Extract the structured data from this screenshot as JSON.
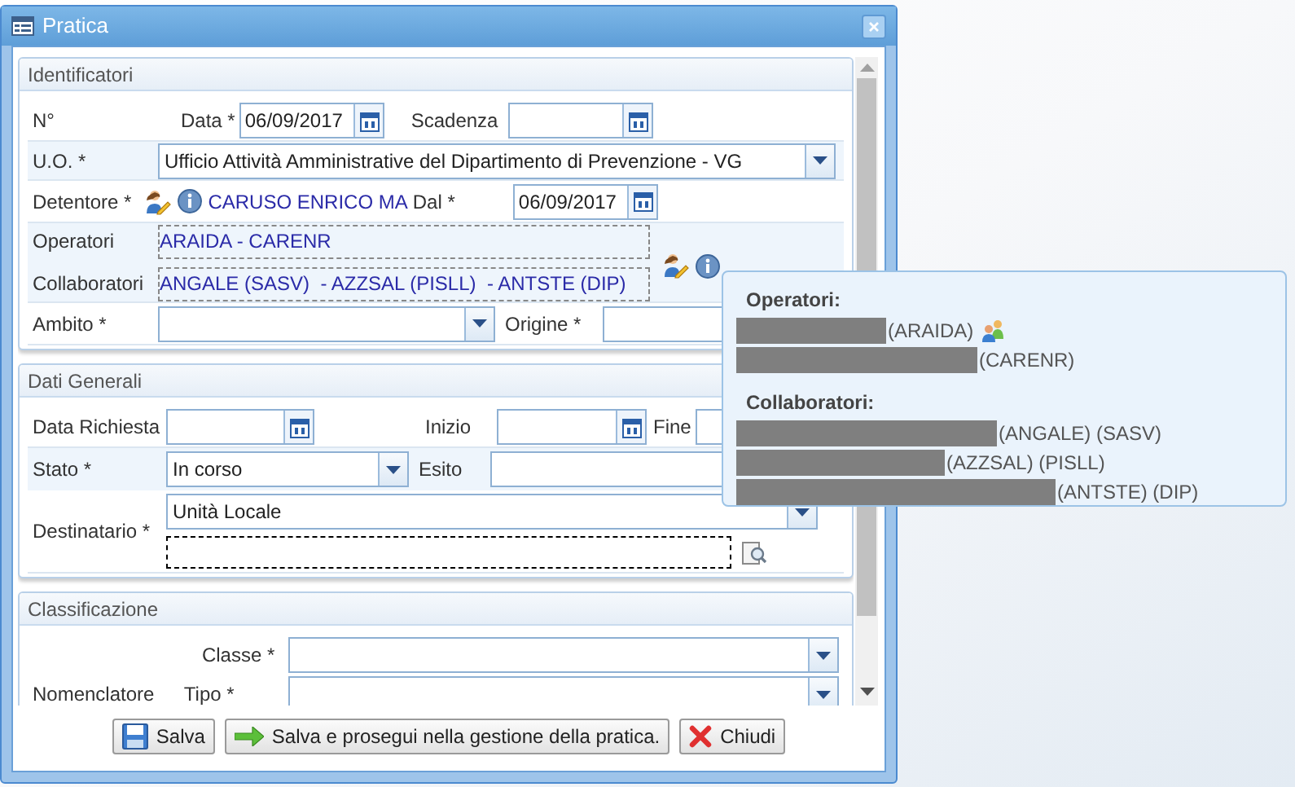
{
  "window": {
    "title": "Pratica"
  },
  "identificatori": {
    "title": "Identificatori",
    "numero_label": "N°",
    "data": {
      "label": "Data *",
      "value": "06/09/2017"
    },
    "scadenza": {
      "label": "Scadenza"
    },
    "uo": {
      "label": "U.O. *",
      "value": "Ufficio Attività Amministrative del Dipartimento di Prevenzione - VG"
    },
    "detentore": {
      "label": "Detentore *",
      "name": "CARUSO ENRICO MA",
      "dal_label": "Dal *",
      "dal_value": "06/09/2017"
    },
    "operatori": {
      "label": "Operatori",
      "value": "ARAIDA - CARENR"
    },
    "collaboratori": {
      "label": "Collaboratori",
      "value": "ANGALE (SASV)  - AZZSAL (PISLL)  - ANTSTE (DIP)"
    },
    "ambito": {
      "label": "Ambito *"
    },
    "origine": {
      "label": "Origine *"
    }
  },
  "dati_generali": {
    "title": "Dati Generali",
    "data_richiesta": {
      "label": "Data Richiesta"
    },
    "inizio": {
      "label": "Inizio"
    },
    "fine": {
      "label": "Fine"
    },
    "stato": {
      "label": "Stato *",
      "value": "In corso"
    },
    "esito": {
      "label": "Esito"
    },
    "destinatario": {
      "label": "Destinatario *",
      "value": "Unità Locale"
    }
  },
  "classificazione": {
    "title": "Classificazione",
    "classe": {
      "label": "Classe *"
    },
    "nomenclatore": {
      "label": "Nomenclatore"
    },
    "tipo": {
      "label": "Tipo *"
    }
  },
  "buttons": [
    {
      "kind": "save",
      "label": "Salva"
    },
    {
      "kind": "forward",
      "label": "Salva e prosegui nella gestione della pratica."
    },
    {
      "kind": "close",
      "label": "Chiudi"
    }
  ],
  "tooltip": {
    "sections": [
      {
        "title": "Operatori:",
        "entries": [
          {
            "code": "(ARAIDA)",
            "group_icon": true
          },
          {
            "code": "(CARENR)",
            "group_icon": false
          }
        ]
      },
      {
        "title": "Collaboratori:",
        "entries": [
          {
            "code": "(ANGALE) (SASV)",
            "group_icon": false
          },
          {
            "code": "(AZZSAL) (PISLL)",
            "group_icon": false
          },
          {
            "code": "(ANTSTE) (DIP)",
            "group_icon": false
          }
        ]
      }
    ]
  }
}
